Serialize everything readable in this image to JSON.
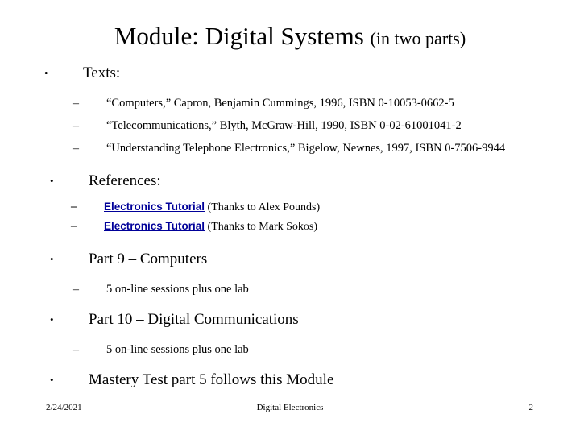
{
  "slide": {
    "title_main": "Module: Digital Systems ",
    "title_sub": "(in two parts)",
    "sections": {
      "texts_heading": "Texts:",
      "texts_items": [
        "“Computers,” Capron, Benjamin Cummings, 1996, ISBN 0-10053-0662-5",
        "“Telecommunications,” Blyth, McGraw-Hill, 1990, ISBN 0-02-61001041-2",
        "“Understanding Telephone Electronics,” Bigelow, Newnes, 1997, ISBN 0-7506-9944"
      ],
      "references_heading": "References:",
      "references_items": [
        {
          "link_label": "Electronics Tutorial",
          "thanks": " (Thanks to Alex Pounds)"
        },
        {
          "link_label": "Electronics Tutorial",
          "thanks": " (Thanks to Mark Sokos)"
        }
      ],
      "part9_heading": "Part 9 – Computers",
      "part9_item": "5 on-line sessions plus one lab",
      "part10_heading": "Part 10 – Digital Communications",
      "part10_item": "5 on-line sessions plus one lab",
      "mastery_heading": "Mastery Test part 5 follows this Module"
    },
    "markers": {
      "bullet": "•",
      "dash": "–"
    },
    "footer": {
      "date": "2/24/2021",
      "center": "Digital Electronics",
      "page": "2"
    },
    "colors": {
      "link": "#000099",
      "text": "#000000",
      "background": "#ffffff"
    }
  }
}
